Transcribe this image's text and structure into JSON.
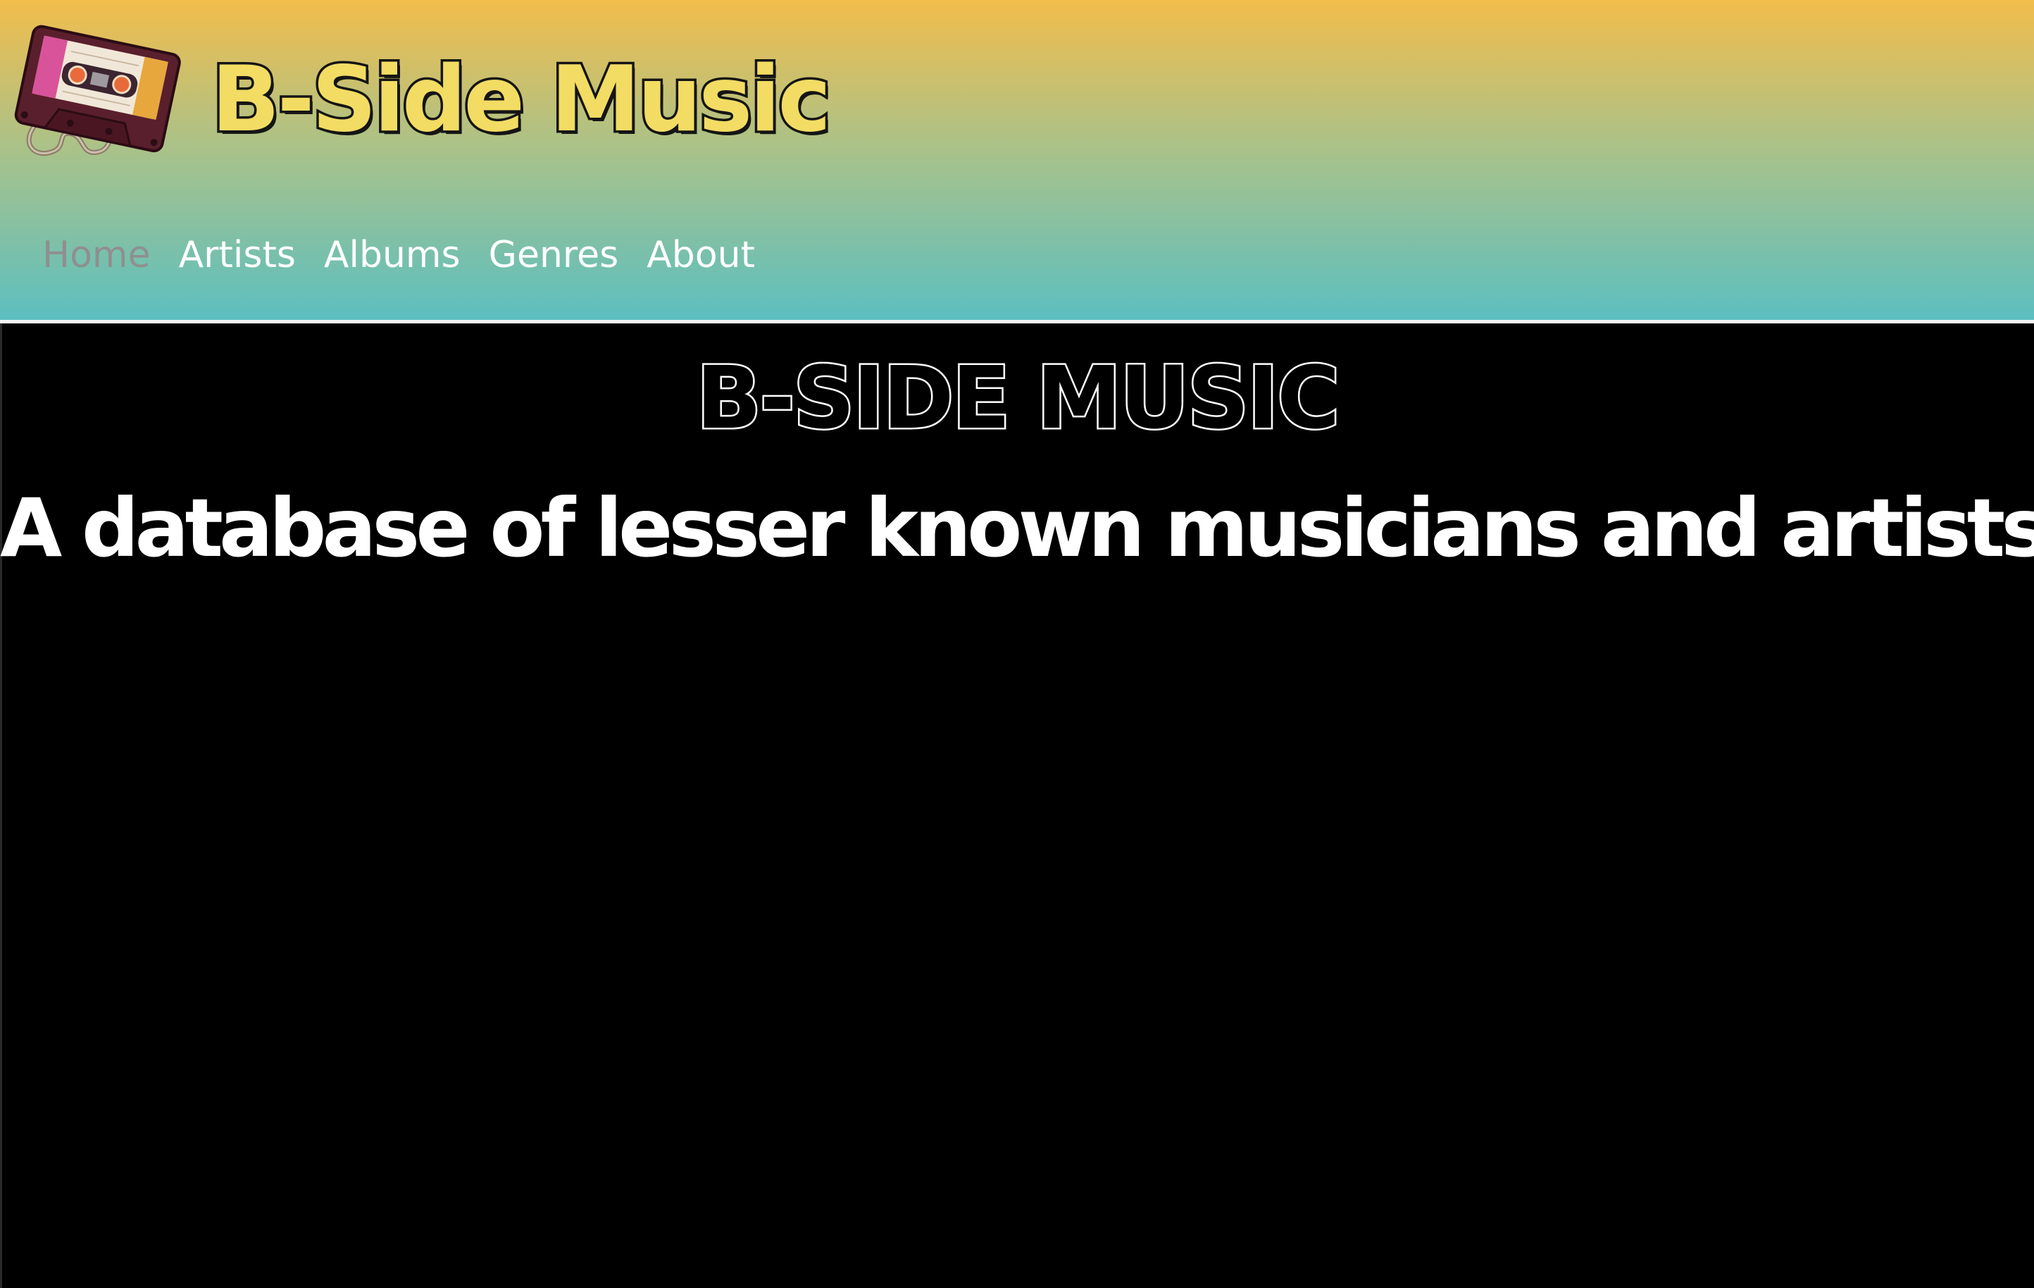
{
  "header": {
    "site_title": "B-Side Music",
    "logo_icon": "cassette-tape-icon"
  },
  "nav": {
    "items": [
      {
        "label": "Home",
        "active": true
      },
      {
        "label": "Artists",
        "active": false
      },
      {
        "label": "Albums",
        "active": false
      },
      {
        "label": "Genres",
        "active": false
      },
      {
        "label": "About",
        "active": false
      }
    ]
  },
  "main": {
    "heading": "B-SIDE MUSIC",
    "tagline": "A database of lesser known musicians and artists."
  },
  "colors": {
    "header_gradient_top": "#f2bd4c",
    "header_gradient_bottom": "#5cbfc0",
    "page_background": "#000000",
    "nav_text": "#ffffff",
    "nav_active": "#8f8f8f",
    "title_fill": "#f2dc63"
  }
}
